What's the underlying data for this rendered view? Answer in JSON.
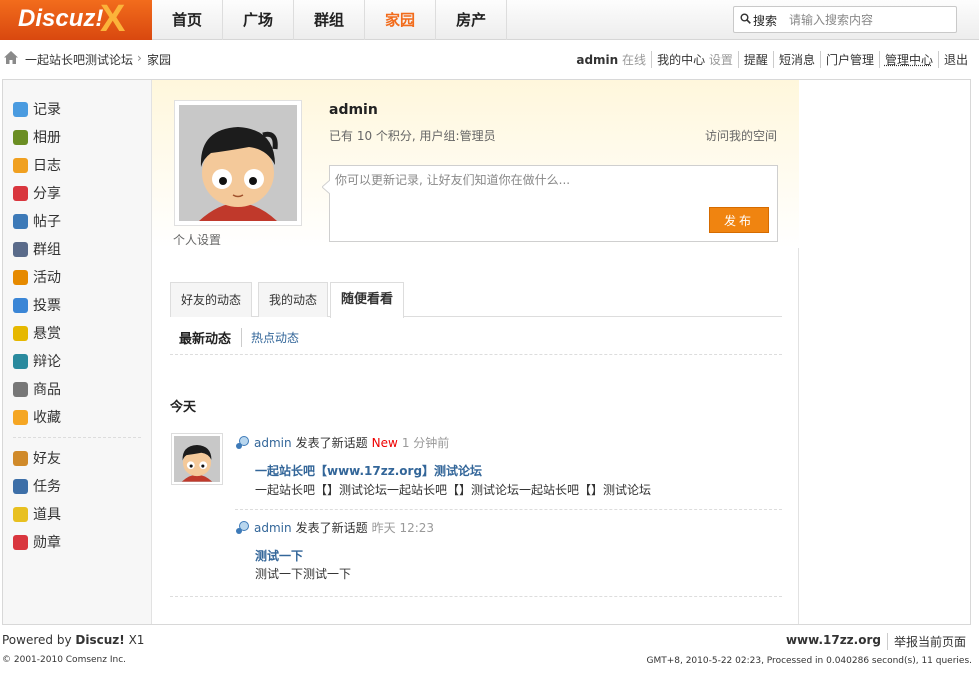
{
  "logo": {
    "text": "Discuz!",
    "mark": "X"
  },
  "nav": [
    {
      "label": "首页"
    },
    {
      "label": "广场"
    },
    {
      "label": "群组"
    },
    {
      "label": "家园",
      "active": true
    },
    {
      "label": "房产"
    }
  ],
  "search": {
    "label": "搜索",
    "placeholder": "请输入搜索内容"
  },
  "breadcrumb": {
    "site": "一起站长吧测试论坛",
    "sep": "›",
    "current": "家园"
  },
  "usermenu": {
    "username": "admin",
    "online": "在线",
    "my_center": "我的中心",
    "settings": "设置",
    "remind": "提醒",
    "messages": "短消息",
    "portal_admin": "门户管理",
    "admin_center": "管理中心",
    "logout": "退出"
  },
  "sidebar": {
    "items": [
      {
        "label": "记录",
        "icon": "record-icon",
        "color": "#4a9be0"
      },
      {
        "label": "相册",
        "icon": "album-icon",
        "color": "#6b8e23"
      },
      {
        "label": "日志",
        "icon": "blog-icon",
        "color": "#f0a020"
      },
      {
        "label": "分享",
        "icon": "share-icon",
        "color": "#d9363e"
      },
      {
        "label": "帖子",
        "icon": "thread-icon",
        "color": "#3d7ab8"
      },
      {
        "label": "群组",
        "icon": "group-icon",
        "color": "#5a6b8a"
      },
      {
        "label": "活动",
        "icon": "activity-icon",
        "color": "#e68a00"
      },
      {
        "label": "投票",
        "icon": "poll-icon",
        "color": "#3b86d6"
      },
      {
        "label": "悬赏",
        "icon": "reward-icon",
        "color": "#e6b800"
      },
      {
        "label": "辩论",
        "icon": "debate-icon",
        "color": "#2a8a9e"
      },
      {
        "label": "商品",
        "icon": "goods-icon",
        "color": "#777777"
      },
      {
        "label": "收藏",
        "icon": "favorite-icon",
        "color": "#f5a623"
      },
      {
        "label": "好友",
        "icon": "friend-icon",
        "color": "#d08a2a"
      },
      {
        "label": "任务",
        "icon": "task-icon",
        "color": "#3d6fa8"
      },
      {
        "label": "道具",
        "icon": "magic-icon",
        "color": "#e8c020"
      },
      {
        "label": "勋章",
        "icon": "medal-icon",
        "color": "#d9363e"
      }
    ]
  },
  "profile": {
    "name": "admin",
    "meta": "已有 10 个积分, 用户组:管理员",
    "visit": "访问我的空间",
    "personal_settings": "个人设置",
    "status_placeholder": "你可以更新记录, 让好友们知道你在做什么...",
    "publish": "发布"
  },
  "tabs": [
    {
      "label": "好友的动态"
    },
    {
      "label": "我的动态"
    },
    {
      "label": "随便看看",
      "active": true
    }
  ],
  "subtabs": {
    "latest": "最新动态",
    "hot": "热点动态"
  },
  "feed": {
    "today": "今天",
    "items": [
      {
        "user": "admin",
        "action": "发表了新话题",
        "badge": "New",
        "time": "1 分钟前",
        "title": "一起站长吧【www.17zz.org】测试论坛",
        "body": "一起站长吧【】测试论坛一起站长吧【】测试论坛一起站长吧【】测试论坛"
      },
      {
        "user": "admin",
        "action": "发表了新话题",
        "badge": "",
        "time": "昨天 12:23",
        "title": "测试一下",
        "body": "测试一下测试一下"
      }
    ]
  },
  "footer": {
    "powered_prefix": "Powered by",
    "powered_brand": "Discuz!",
    "powered_version": "X1",
    "copyright": "© 2001-2010 Comsenz Inc.",
    "site": "www.17zz.org",
    "report": "举报当前页面",
    "stats": "GMT+8, 2010-5-22 02:23, Processed in 0.040286 second(s), 11 queries."
  }
}
